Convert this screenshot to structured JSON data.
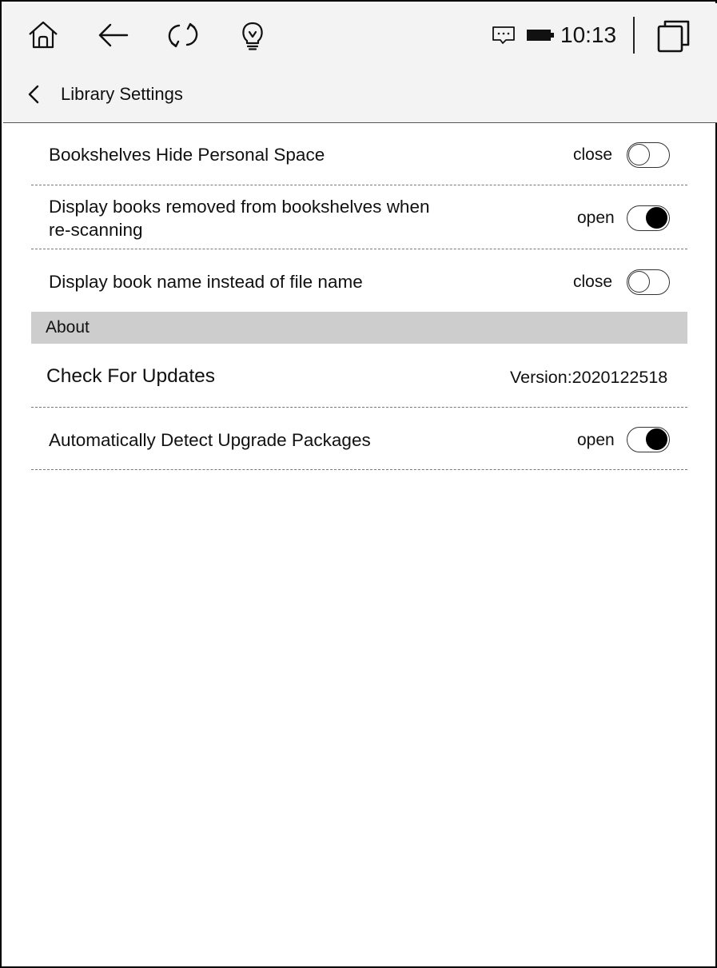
{
  "status_bar": {
    "time": "10:13",
    "icons": [
      "home-icon",
      "back-arrow-icon",
      "refresh-icon",
      "lightbulb-icon",
      "message-icon",
      "battery-icon",
      "recent-apps-icon"
    ]
  },
  "header": {
    "title": "Library Settings",
    "back_icon": "chevron-left-icon"
  },
  "settings": [
    {
      "label": "Bookshelves Hide Personal Space",
      "state": "close",
      "on": false
    },
    {
      "label_line1": "Display books removed from bookshelves when",
      "label_line2": "re-scanning",
      "state": "open",
      "on": true
    },
    {
      "label": "Display book name instead of file name",
      "state": "close",
      "on": false
    }
  ],
  "about": {
    "section_title": "About",
    "check_updates_label": "Check For Updates",
    "version": "Version:2020122518",
    "auto_detect_label": "Automatically Detect Upgrade Packages",
    "auto_detect_state": "open",
    "auto_detect_on": true
  }
}
